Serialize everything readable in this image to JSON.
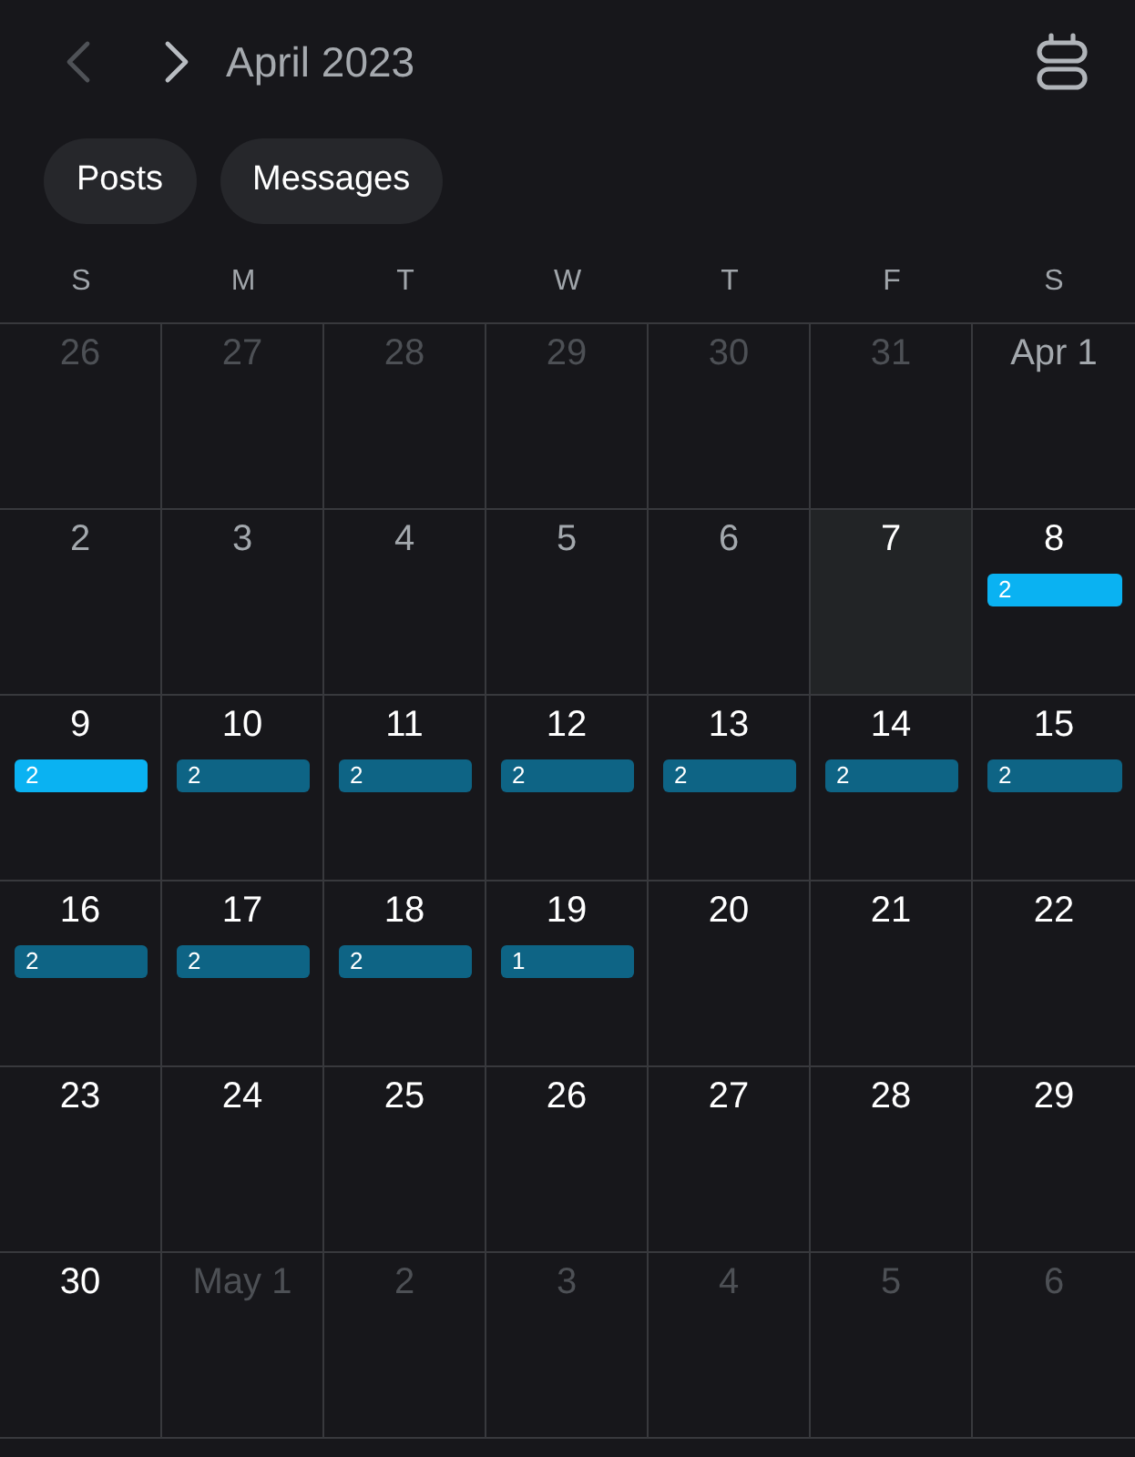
{
  "header": {
    "prev_button": {
      "disabled": true
    },
    "next_button": {
      "disabled": false
    },
    "title": "April 2023"
  },
  "filters": [
    {
      "label": "Posts"
    },
    {
      "label": "Messages"
    }
  ],
  "weekdays": [
    "S",
    "M",
    "T",
    "W",
    "T",
    "F",
    "S"
  ],
  "weeks": [
    {
      "days": [
        {
          "label": "26",
          "kind": "outside"
        },
        {
          "label": "27",
          "kind": "outside"
        },
        {
          "label": "28",
          "kind": "outside"
        },
        {
          "label": "29",
          "kind": "outside"
        },
        {
          "label": "30",
          "kind": "outside"
        },
        {
          "label": "31",
          "kind": "outside"
        },
        {
          "label": "Apr 1",
          "kind": "past"
        }
      ]
    },
    {
      "days": [
        {
          "label": "2",
          "kind": "past"
        },
        {
          "label": "3",
          "kind": "past"
        },
        {
          "label": "4",
          "kind": "past"
        },
        {
          "label": "5",
          "kind": "past"
        },
        {
          "label": "6",
          "kind": "past"
        },
        {
          "label": "7",
          "kind": "today"
        },
        {
          "label": "8",
          "kind": "upcoming",
          "event": {
            "count": "2",
            "color": "#0ab2f2"
          }
        }
      ]
    },
    {
      "days": [
        {
          "label": "9",
          "kind": "upcoming",
          "event": {
            "count": "2",
            "color": "#0ab2f2"
          }
        },
        {
          "label": "10",
          "kind": "upcoming",
          "event": {
            "count": "2",
            "color": "#0e6485"
          }
        },
        {
          "label": "11",
          "kind": "upcoming",
          "event": {
            "count": "2",
            "color": "#0e6485"
          }
        },
        {
          "label": "12",
          "kind": "upcoming",
          "event": {
            "count": "2",
            "color": "#0e6485"
          }
        },
        {
          "label": "13",
          "kind": "upcoming",
          "event": {
            "count": "2",
            "color": "#0e6485"
          }
        },
        {
          "label": "14",
          "kind": "upcoming",
          "event": {
            "count": "2",
            "color": "#0e6485"
          }
        },
        {
          "label": "15",
          "kind": "upcoming",
          "event": {
            "count": "2",
            "color": "#0e6485"
          }
        }
      ]
    },
    {
      "days": [
        {
          "label": "16",
          "kind": "upcoming",
          "event": {
            "count": "2",
            "color": "#0e6485"
          }
        },
        {
          "label": "17",
          "kind": "upcoming",
          "event": {
            "count": "2",
            "color": "#0e6485"
          }
        },
        {
          "label": "18",
          "kind": "upcoming",
          "event": {
            "count": "2",
            "color": "#0e6485"
          }
        },
        {
          "label": "19",
          "kind": "upcoming",
          "event": {
            "count": "1",
            "color": "#0e6485"
          }
        },
        {
          "label": "20",
          "kind": "upcoming"
        },
        {
          "label": "21",
          "kind": "upcoming"
        },
        {
          "label": "22",
          "kind": "upcoming"
        }
      ]
    },
    {
      "days": [
        {
          "label": "23",
          "kind": "upcoming"
        },
        {
          "label": "24",
          "kind": "upcoming"
        },
        {
          "label": "25",
          "kind": "upcoming"
        },
        {
          "label": "26",
          "kind": "upcoming"
        },
        {
          "label": "27",
          "kind": "upcoming"
        },
        {
          "label": "28",
          "kind": "upcoming"
        },
        {
          "label": "29",
          "kind": "upcoming"
        }
      ]
    },
    {
      "days": [
        {
          "label": "30",
          "kind": "upcoming"
        },
        {
          "label": "May 1",
          "kind": "outside"
        },
        {
          "label": "2",
          "kind": "outside"
        },
        {
          "label": "3",
          "kind": "outside"
        },
        {
          "label": "4",
          "kind": "outside"
        },
        {
          "label": "5",
          "kind": "outside"
        },
        {
          "label": "6",
          "kind": "outside"
        }
      ]
    }
  ]
}
